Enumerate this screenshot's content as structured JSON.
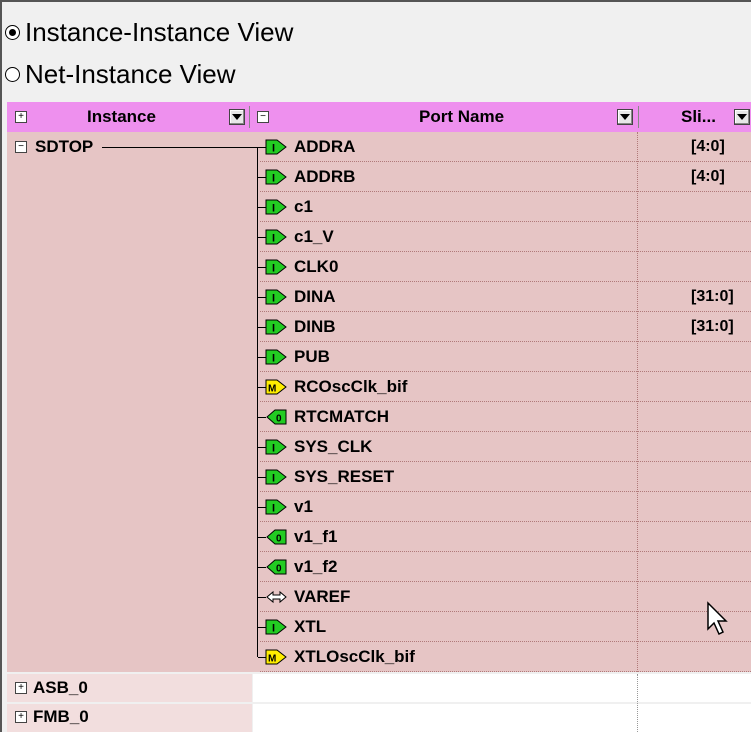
{
  "view_options": [
    {
      "label": "Instance-Instance View",
      "selected": true
    },
    {
      "label": "Net-Instance View",
      "selected": false
    }
  ],
  "columns": {
    "instance": "Instance",
    "port_name": "Port Name",
    "slice": "Sli..."
  },
  "expanded_instance": {
    "name": "SDTOP",
    "ports": [
      {
        "type": "I",
        "name": "ADDRA",
        "slice": "[4:0]"
      },
      {
        "type": "I",
        "name": "ADDRB",
        "slice": "[4:0]"
      },
      {
        "type": "I",
        "name": "c1",
        "slice": ""
      },
      {
        "type": "I",
        "name": "c1_V",
        "slice": ""
      },
      {
        "type": "I",
        "name": "CLK0",
        "slice": ""
      },
      {
        "type": "I",
        "name": "DINA",
        "slice": "[31:0]"
      },
      {
        "type": "I",
        "name": "DINB",
        "slice": "[31:0]"
      },
      {
        "type": "I",
        "name": "PUB",
        "slice": ""
      },
      {
        "type": "M",
        "name": "RCOscClk_bif",
        "slice": ""
      },
      {
        "type": "O",
        "name": "RTCMATCH",
        "slice": ""
      },
      {
        "type": "I",
        "name": "SYS_CLK",
        "slice": ""
      },
      {
        "type": "I",
        "name": "SYS_RESET",
        "slice": ""
      },
      {
        "type": "I",
        "name": "v1",
        "slice": ""
      },
      {
        "type": "O",
        "name": "v1_f1",
        "slice": ""
      },
      {
        "type": "O",
        "name": "v1_f2",
        "slice": ""
      },
      {
        "type": "B",
        "name": "VAREF",
        "slice": ""
      },
      {
        "type": "I",
        "name": "XTL",
        "slice": ""
      },
      {
        "type": "M",
        "name": "XTLOscClk_bif",
        "slice": ""
      }
    ]
  },
  "collapsed_instances": [
    "ASB_0",
    "FMB_0"
  ],
  "colors": {
    "header": "#ee90ee",
    "row_bg": "#e6c5c5",
    "input_pin": "#22cc22",
    "output_pin": "#22cc22",
    "mixed_pin": "#ffee00"
  }
}
